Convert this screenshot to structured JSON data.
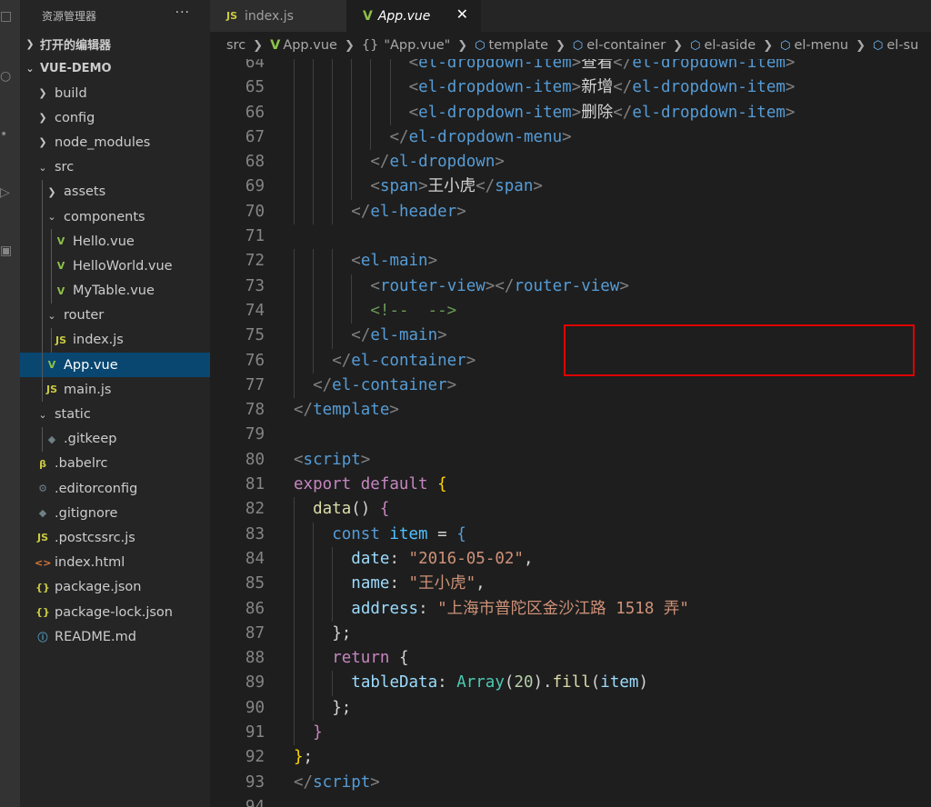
{
  "sidebar": {
    "title": "资源管理器",
    "open_editors": "打开的编辑器",
    "project": "VUE-DEMO",
    "tree": [
      {
        "label": "build",
        "kind": "folder",
        "level": 0,
        "icon": "chevron-right"
      },
      {
        "label": "config",
        "kind": "folder",
        "level": 0,
        "icon": "chevron-right"
      },
      {
        "label": "node_modules",
        "kind": "folder",
        "level": 0,
        "icon": "chevron-right"
      },
      {
        "label": "src",
        "kind": "folder",
        "level": 0,
        "icon": "chevron-down"
      },
      {
        "label": "assets",
        "kind": "folder",
        "level": 1,
        "icon": "chevron-right"
      },
      {
        "label": "components",
        "kind": "folder",
        "level": 1,
        "icon": "chevron-down"
      },
      {
        "label": "Hello.vue",
        "kind": "vue",
        "level": 2
      },
      {
        "label": "HelloWorld.vue",
        "kind": "vue",
        "level": 2
      },
      {
        "label": "MyTable.vue",
        "kind": "vue",
        "level": 2
      },
      {
        "label": "router",
        "kind": "folder",
        "level": 1,
        "icon": "chevron-down"
      },
      {
        "label": "index.js",
        "kind": "js",
        "level": 2
      },
      {
        "label": "App.vue",
        "kind": "vue",
        "level": 1,
        "selected": true
      },
      {
        "label": "main.js",
        "kind": "js",
        "level": 1
      },
      {
        "label": "static",
        "kind": "folder",
        "level": 0,
        "icon": "chevron-down"
      },
      {
        "label": ".gitkeep",
        "kind": "git",
        "level": 1
      },
      {
        "label": ".babelrc",
        "kind": "babel",
        "level": 0
      },
      {
        "label": ".editorconfig",
        "kind": "gear",
        "level": 0
      },
      {
        "label": ".gitignore",
        "kind": "git",
        "level": 0
      },
      {
        "label": ".postcssrc.js",
        "kind": "js",
        "level": 0
      },
      {
        "label": "index.html",
        "kind": "html",
        "level": 0
      },
      {
        "label": "package.json",
        "kind": "json",
        "level": 0
      },
      {
        "label": "package-lock.json",
        "kind": "json",
        "level": 0
      },
      {
        "label": "README.md",
        "kind": "info",
        "level": 0
      }
    ]
  },
  "tabs": [
    {
      "label": "index.js",
      "badge": "JS"
    },
    {
      "label": "App.vue",
      "badge": "V",
      "active": true
    }
  ],
  "breadcrumb": [
    "src",
    "App.vue",
    "\"App.vue\"",
    "template",
    "el-container",
    "el-aside",
    "el-menu",
    "el-su"
  ],
  "breadcrumb_braces": "{}",
  "code": [
    {
      "n": "64",
      "indent": 6,
      "tokens": [
        [
          "punc",
          "<"
        ],
        [
          "tag",
          "el-dropdown-item"
        ],
        [
          "punc",
          ">"
        ],
        [
          "text",
          "查看"
        ],
        [
          "punc",
          "</"
        ],
        [
          "tag",
          "el-dropdown-item"
        ],
        [
          "punc",
          ">"
        ]
      ]
    },
    {
      "n": "65",
      "indent": 6,
      "tokens": [
        [
          "punc",
          "<"
        ],
        [
          "tag",
          "el-dropdown-item"
        ],
        [
          "punc",
          ">"
        ],
        [
          "text",
          "新增"
        ],
        [
          "punc",
          "</"
        ],
        [
          "tag",
          "el-dropdown-item"
        ],
        [
          "punc",
          ">"
        ]
      ]
    },
    {
      "n": "66",
      "indent": 6,
      "tokens": [
        [
          "punc",
          "<"
        ],
        [
          "tag",
          "el-dropdown-item"
        ],
        [
          "punc",
          ">"
        ],
        [
          "text",
          "删除"
        ],
        [
          "punc",
          "</"
        ],
        [
          "tag",
          "el-dropdown-item"
        ],
        [
          "punc",
          ">"
        ]
      ]
    },
    {
      "n": "67",
      "indent": 5,
      "tokens": [
        [
          "punc",
          "</"
        ],
        [
          "tag",
          "el-dropdown-menu"
        ],
        [
          "punc",
          ">"
        ]
      ]
    },
    {
      "n": "68",
      "indent": 4,
      "tokens": [
        [
          "punc",
          "</"
        ],
        [
          "tag",
          "el-dropdown"
        ],
        [
          "punc",
          ">"
        ]
      ]
    },
    {
      "n": "69",
      "indent": 4,
      "tokens": [
        [
          "punc",
          "<"
        ],
        [
          "tag",
          "span"
        ],
        [
          "punc",
          ">"
        ],
        [
          "text",
          "王小虎"
        ],
        [
          "punc",
          "</"
        ],
        [
          "tag",
          "span"
        ],
        [
          "punc",
          ">"
        ]
      ]
    },
    {
      "n": "70",
      "indent": 3,
      "tokens": [
        [
          "punc",
          "</"
        ],
        [
          "tag",
          "el-header"
        ],
        [
          "punc",
          ">"
        ]
      ]
    },
    {
      "n": "71",
      "indent": 0,
      "tokens": []
    },
    {
      "n": "72",
      "indent": 3,
      "tokens": [
        [
          "punc",
          "<"
        ],
        [
          "tag",
          "el-main"
        ],
        [
          "punc",
          ">"
        ]
      ]
    },
    {
      "n": "73",
      "indent": 4,
      "tokens": [
        [
          "punc",
          "<"
        ],
        [
          "tag",
          "router-view"
        ],
        [
          "punc",
          "></"
        ],
        [
          "tag",
          "router-view"
        ],
        [
          "punc",
          ">"
        ]
      ]
    },
    {
      "n": "74",
      "indent": 4,
      "tokens": [
        [
          "com",
          "<!--  -->"
        ]
      ]
    },
    {
      "n": "75",
      "indent": 3,
      "tokens": [
        [
          "punc",
          "</"
        ],
        [
          "tag",
          "el-main"
        ],
        [
          "punc",
          ">"
        ]
      ]
    },
    {
      "n": "76",
      "indent": 2,
      "tokens": [
        [
          "punc",
          "</"
        ],
        [
          "tag",
          "el-container"
        ],
        [
          "punc",
          ">"
        ]
      ]
    },
    {
      "n": "77",
      "indent": 1,
      "tokens": [
        [
          "punc",
          "</"
        ],
        [
          "tag",
          "el-container"
        ],
        [
          "punc",
          ">"
        ]
      ]
    },
    {
      "n": "78",
      "indent": 0,
      "tokens": [
        [
          "punc",
          "</"
        ],
        [
          "tag",
          "template"
        ],
        [
          "punc",
          ">"
        ]
      ]
    },
    {
      "n": "79",
      "indent": 0,
      "tokens": []
    },
    {
      "n": "80",
      "indent": 0,
      "tokens": [
        [
          "punc",
          "<"
        ],
        [
          "tag",
          "script"
        ],
        [
          "punc",
          ">"
        ]
      ]
    },
    {
      "n": "81",
      "indent": 0,
      "tokens": [
        [
          "kw",
          "export"
        ],
        [
          "text",
          " "
        ],
        [
          "kw",
          "default"
        ],
        [
          "text",
          " "
        ],
        [
          "br",
          "{"
        ]
      ]
    },
    {
      "n": "82",
      "indent": 1,
      "tokens": [
        [
          "fn",
          "data"
        ],
        [
          "text",
          "() "
        ],
        [
          "kw",
          "{"
        ]
      ]
    },
    {
      "n": "83",
      "indent": 2,
      "tokens": [
        [
          "kw2",
          "const"
        ],
        [
          "text",
          " "
        ],
        [
          "var",
          "item"
        ],
        [
          "text",
          " = "
        ],
        [
          "kw2",
          "{"
        ]
      ]
    },
    {
      "n": "84",
      "indent": 3,
      "tokens": [
        [
          "prop",
          "date"
        ],
        [
          "text",
          ": "
        ],
        [
          "str",
          "\"2016-05-02\""
        ],
        [
          "text",
          ","
        ]
      ]
    },
    {
      "n": "85",
      "indent": 3,
      "tokens": [
        [
          "prop",
          "name"
        ],
        [
          "text",
          ": "
        ],
        [
          "str",
          "\"王小虎\""
        ],
        [
          "text",
          ","
        ]
      ]
    },
    {
      "n": "86",
      "indent": 3,
      "tokens": [
        [
          "prop",
          "address"
        ],
        [
          "text",
          ": "
        ],
        [
          "str",
          "\"上海市普陀区金沙江路 1518 弄\""
        ]
      ]
    },
    {
      "n": "87",
      "indent": 2,
      "tokens": [
        [
          "text",
          "};"
        ]
      ]
    },
    {
      "n": "88",
      "indent": 2,
      "tokens": [
        [
          "kw",
          "return"
        ],
        [
          "text",
          " {"
        ]
      ]
    },
    {
      "n": "89",
      "indent": 3,
      "tokens": [
        [
          "prop",
          "tableData"
        ],
        [
          "text",
          ": "
        ],
        [
          "cls",
          "Array"
        ],
        [
          "text",
          "("
        ],
        [
          "num",
          "20"
        ],
        [
          "text",
          ")."
        ],
        [
          "fn",
          "fill"
        ],
        [
          "text",
          "("
        ],
        [
          "prop",
          "item"
        ],
        [
          "text",
          ")"
        ]
      ]
    },
    {
      "n": "90",
      "indent": 2,
      "tokens": [
        [
          "text",
          "};"
        ]
      ]
    },
    {
      "n": "91",
      "indent": 1,
      "tokens": [
        [
          "kw",
          "}"
        ]
      ]
    },
    {
      "n": "92",
      "indent": 0,
      "tokens": [
        [
          "br",
          "}"
        ],
        [
          "text",
          ";"
        ]
      ]
    },
    {
      "n": "93",
      "indent": 0,
      "tokens": [
        [
          "punc",
          "</"
        ],
        [
          "tag",
          "script"
        ],
        [
          "punc",
          ">"
        ]
      ]
    },
    {
      "n": "94",
      "indent": 0,
      "tokens": []
    }
  ],
  "highlight_lines": [
    "73",
    "74"
  ],
  "colors": {
    "editor_bg": "#1e1e1e",
    "sidebar_bg": "#252526",
    "selection": "#094771",
    "highlight_box": "#e00000",
    "vue_icon": "#8dc149",
    "js_icon": "#cbcb41"
  }
}
